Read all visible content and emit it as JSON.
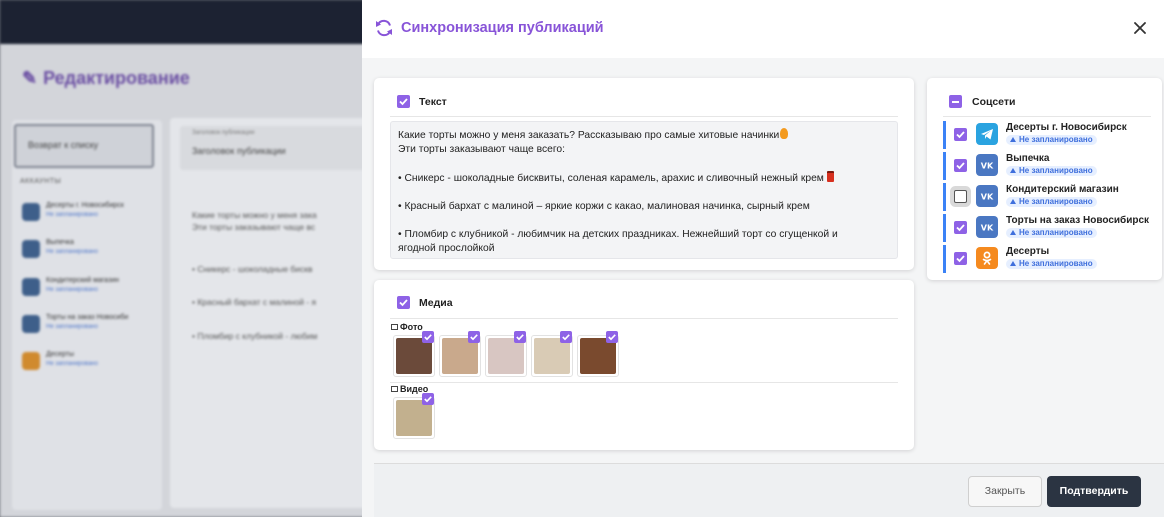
{
  "background": {
    "page_title": "Редактирование",
    "preview_button": "Возврат к списку",
    "accounts_section": "АККАУНТЫ",
    "accounts": [
      {
        "name": "Десерты г. Новосибирск",
        "status": "Не запланировано"
      },
      {
        "name": "Выпечка",
        "status": "Не запланировано"
      },
      {
        "name": "Кондитерский магазин",
        "status": "Не запланировано"
      },
      {
        "name": "Торты на заказ Новосиби",
        "status": "Не запланировано"
      },
      {
        "name": "Десерты",
        "status": "Не запланировано"
      }
    ],
    "title_field_label": "Заголовок публикации",
    "title_field_value": "Заголовок публикации",
    "text_lines": [
      "Какие торты можно у меня зака",
      "Эти торты заказывают чаще вс",
      "• Сникерс - шоколадные бискв",
      "• Красный бархат с малиной - я",
      "• Пломбир с клубникой - любим"
    ]
  },
  "modal": {
    "title": "Синхронизация публикаций",
    "icons": {
      "header": "sync-icon",
      "close": "close-icon"
    },
    "text_section": {
      "label": "Текст",
      "checked": true,
      "lines": [
        "Какие торты можно у меня заказать? Рассказываю про самые хитовые начинки",
        "Эти торты заказывают чаще всего:",
        "",
        "• Сникерс - шоколадные бисквиты, соленая карамель, арахис и сливочный нежный крем",
        "",
        "• Красный бархат с малиной – яркие коржи с какао, малиновая начинка, сырный крем",
        "",
        "• Пломбир с клубникой - любимчик на детских праздниках. Нежнейший торт со сгущенкой и",
        "ягодной прослойкой"
      ]
    },
    "media_section": {
      "label": "Медиа",
      "checked": true,
      "photo_label": "Фото",
      "video_label": "Видео",
      "photos": [
        {
          "name": "photo-1",
          "color": "#6b4a3a",
          "checked": true
        },
        {
          "name": "photo-2",
          "color": "#c9a98c",
          "checked": true
        },
        {
          "name": "photo-3",
          "color": "#d8c6c2",
          "checked": true
        },
        {
          "name": "photo-4",
          "color": "#d9cbb5",
          "checked": true
        },
        {
          "name": "photo-5",
          "color": "#7a4a2e",
          "checked": true
        }
      ],
      "videos": [
        {
          "name": "video-1",
          "color": "#c2b08e",
          "checked": true
        }
      ]
    },
    "social_section": {
      "label": "Соцсети",
      "state": "indeterminate",
      "accounts": [
        {
          "name": "Десерты г. Новосибирск",
          "network": "telegram",
          "icon": "telegram-icon",
          "color": "#2aa3e0",
          "status": "Не запланировано",
          "checked": true
        },
        {
          "name": "Выпечка",
          "network": "vk",
          "icon": "vk-icon",
          "color": "#4a77c2",
          "status": "Не запланировано",
          "checked": true
        },
        {
          "name": "Кондитерский магазин",
          "network": "vk",
          "icon": "vk-icon",
          "color": "#4a77c2",
          "status": "Не запланировано",
          "checked": false
        },
        {
          "name": "Торты на заказ Новосибирск",
          "network": "vk",
          "icon": "vk-icon",
          "color": "#4a77c2",
          "status": "Не запланировано",
          "checked": true
        },
        {
          "name": "Десерты",
          "network": "ok",
          "icon": "odnoklassniki-icon",
          "color": "#f58a1f",
          "status": "Не запланировано",
          "checked": true
        }
      ]
    },
    "footer": {
      "cancel_label": "Закрыть",
      "confirm_label": "Подтвердить"
    }
  }
}
